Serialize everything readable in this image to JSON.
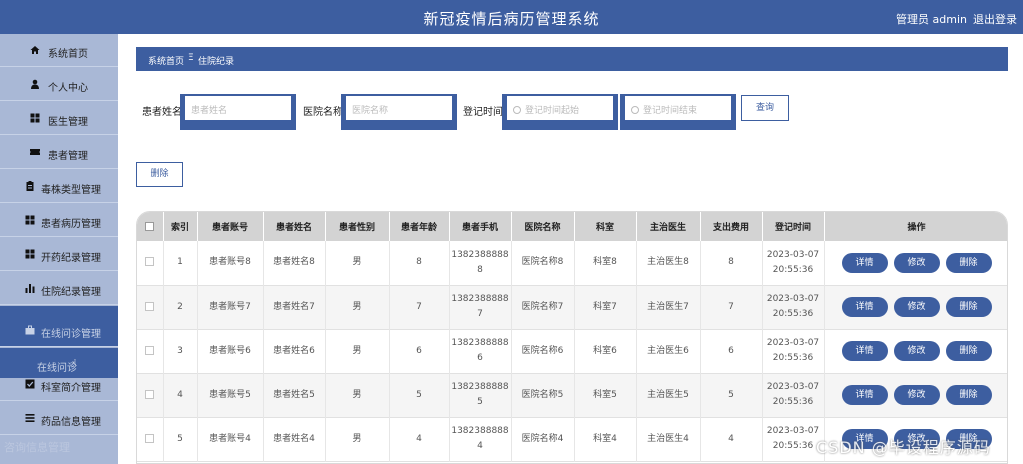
{
  "header": {
    "title": "新冠疫情后病历管理系统",
    "admin": "管理员 admin",
    "logout": "退出登录"
  },
  "sidebar": {
    "items": [
      {
        "label": "系统首页",
        "icon": "home-icon"
      },
      {
        "label": "个人中心",
        "icon": "user-icon"
      },
      {
        "label": "医生管理",
        "icon": "grid-icon"
      },
      {
        "label": "患者管理",
        "icon": "ticket-icon"
      },
      {
        "label": "毒株类型管理",
        "icon": "clipboard-icon"
      },
      {
        "label": "患者病历管理",
        "icon": "grid-icon"
      },
      {
        "label": "开药纪录管理",
        "icon": "grid-icon"
      },
      {
        "label": "住院纪录管理",
        "icon": "bar-chart-icon"
      },
      {
        "label": "在线问诊管理",
        "icon": "briefcase-icon"
      },
      {
        "label": "科室简介管理",
        "icon": "check-square-icon"
      },
      {
        "label": "药品信息管理",
        "icon": "list-icon"
      }
    ],
    "submenu_item": "在线问诊",
    "faded_text": "咨询信息管理"
  },
  "breadcrumb": {
    "home": "系统首页",
    "separator": "Ξ",
    "current": "住院纪录"
  },
  "filters": {
    "patient_name_label": "患者姓名",
    "patient_name_placeholder": "患者姓名",
    "hospital_label": "医院名称",
    "hospital_placeholder": "医院名称",
    "date_label": "登记时间",
    "date_start_placeholder": "登记时间起始",
    "date_end_placeholder": "登记时间结束",
    "search_label": "查询",
    "delete_label": "删除"
  },
  "table": {
    "columns": [
      "索引",
      "患者账号",
      "患者姓名",
      "患者性别",
      "患者年龄",
      "患者手机",
      "医院名称",
      "科室",
      "主治医生",
      "支出费用",
      "登记时间",
      "操作"
    ],
    "action_labels": {
      "detail": "详情",
      "edit": "修改",
      "delete": "删除"
    },
    "rows": [
      {
        "index": "1",
        "account": "患者账号8",
        "name": "患者姓名8",
        "gender": "男",
        "age": "8",
        "phone1": "1382388888",
        "phone2": "8",
        "hospital": "医院名称8",
        "dept": "科室8",
        "doctor": "主治医生8",
        "fee": "8",
        "date1": "2023-03-07",
        "date2": "20:55:36"
      },
      {
        "index": "2",
        "account": "患者账号7",
        "name": "患者姓名7",
        "gender": "男",
        "age": "7",
        "phone1": "1382388888",
        "phone2": "7",
        "hospital": "医院名称7",
        "dept": "科室7",
        "doctor": "主治医生7",
        "fee": "7",
        "date1": "2023-03-07",
        "date2": "20:55:36"
      },
      {
        "index": "3",
        "account": "患者账号6",
        "name": "患者姓名6",
        "gender": "男",
        "age": "6",
        "phone1": "1382388888",
        "phone2": "6",
        "hospital": "医院名称6",
        "dept": "科室6",
        "doctor": "主治医生6",
        "fee": "6",
        "date1": "2023-03-07",
        "date2": "20:55:36"
      },
      {
        "index": "4",
        "account": "患者账号5",
        "name": "患者姓名5",
        "gender": "男",
        "age": "5",
        "phone1": "1382388888",
        "phone2": "5",
        "hospital": "医院名称5",
        "dept": "科室5",
        "doctor": "主治医生5",
        "fee": "5",
        "date1": "2023-03-07",
        "date2": "20:55:36"
      },
      {
        "index": "5",
        "account": "患者账号4",
        "name": "患者姓名4",
        "gender": "男",
        "age": "4",
        "phone1": "1382388888",
        "phone2": "4",
        "hospital": "医院名称4",
        "dept": "科室4",
        "doctor": "主治医生4",
        "fee": "4",
        "date1": "2023-03-07",
        "date2": "20:55:36"
      }
    ]
  },
  "watermark": "CSDN @毕设程序源码",
  "colors": {
    "primary": "#3d5ea0",
    "sidebar_bg": "#a9b8d6",
    "table_header": "#d3d3d3"
  }
}
